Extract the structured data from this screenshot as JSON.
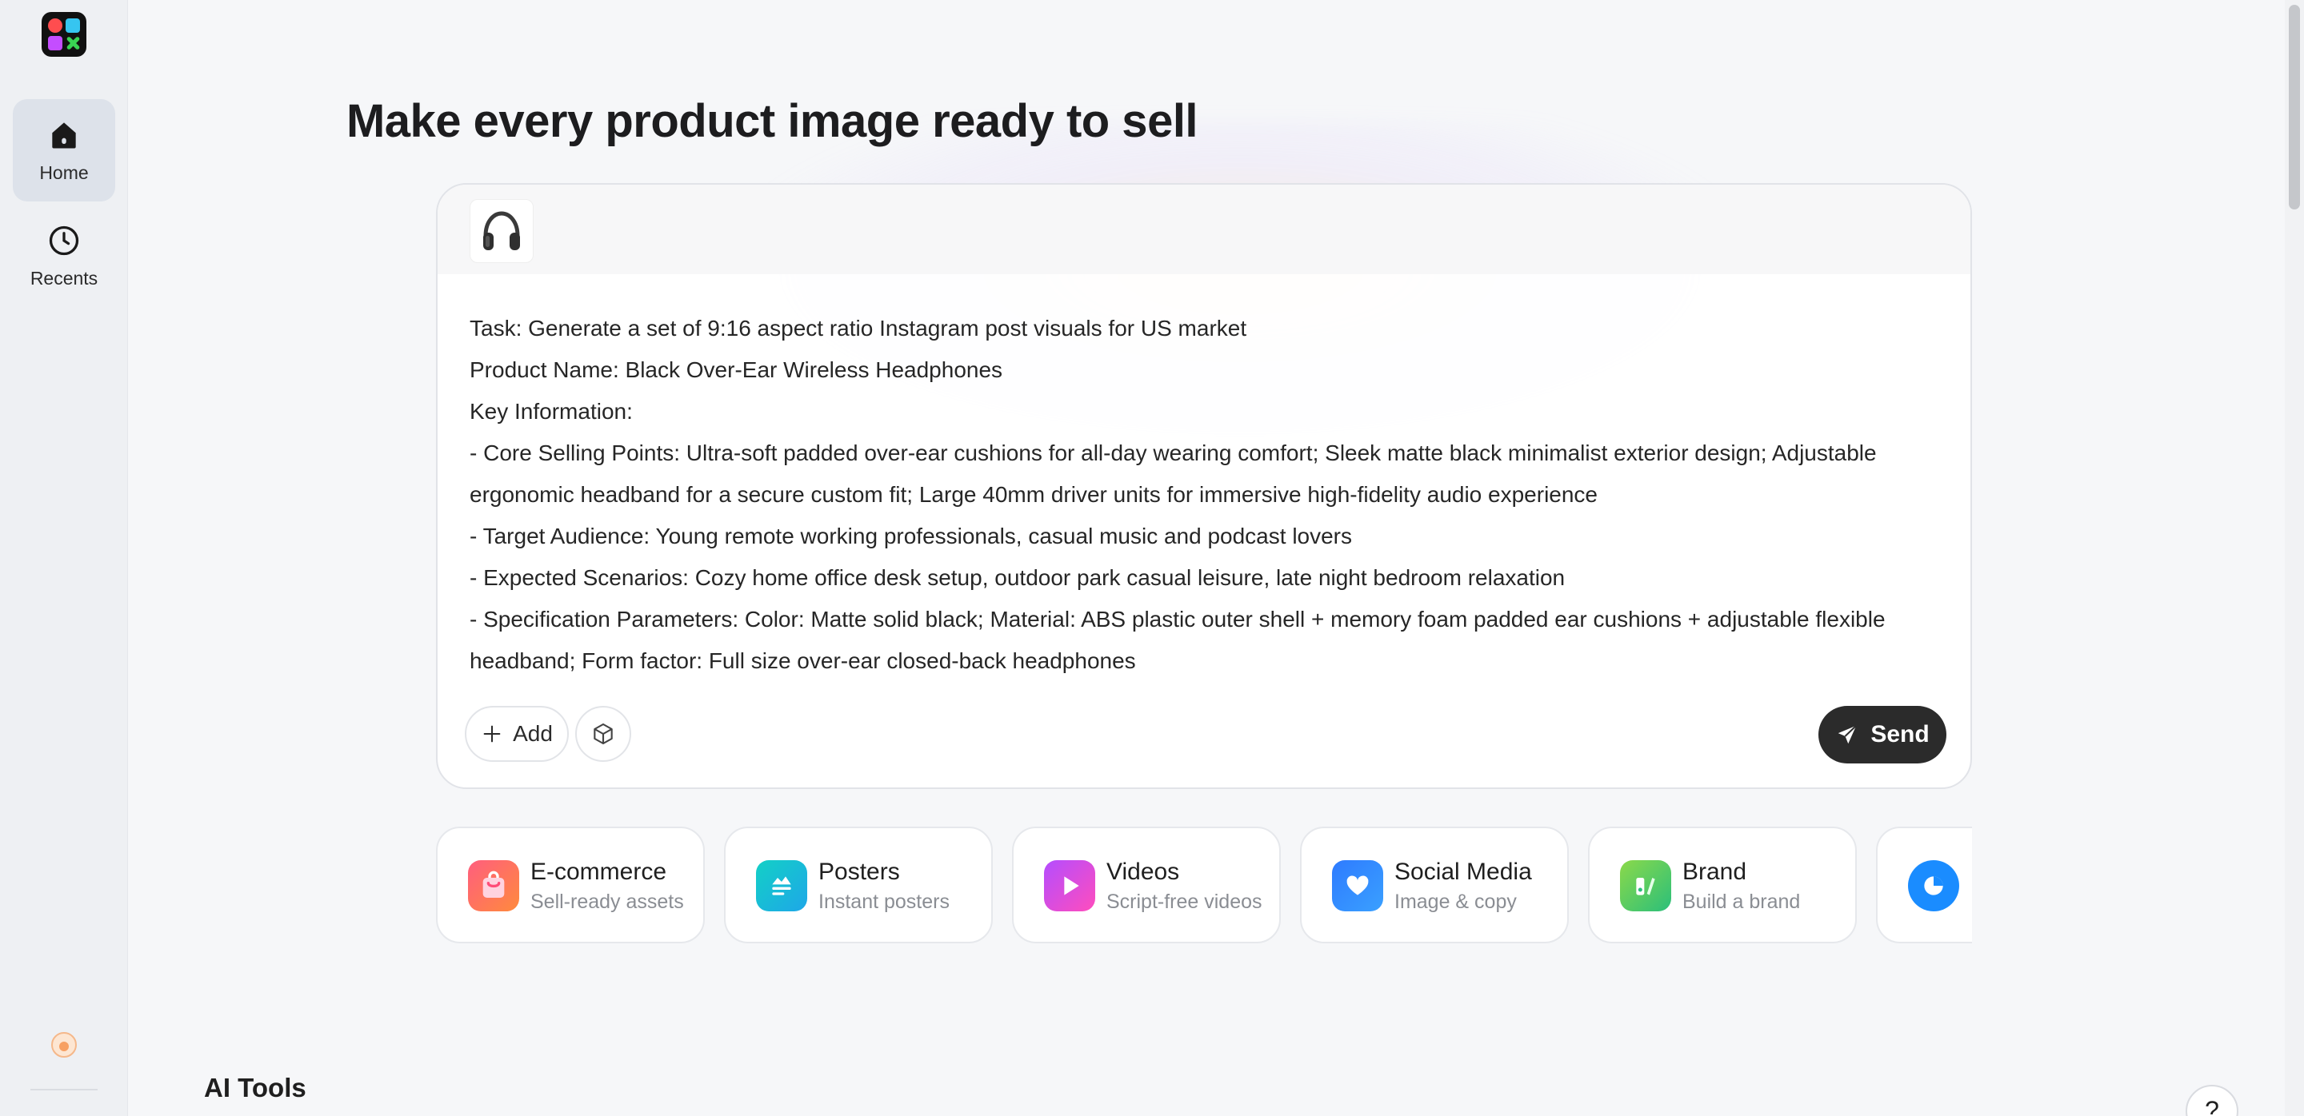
{
  "sidebar": {
    "items": [
      {
        "label": "Home",
        "icon": "home-icon",
        "active": true
      },
      {
        "label": "Recents",
        "icon": "clock-icon",
        "active": false
      }
    ]
  },
  "hero": {
    "title": "Make every product image ready to sell"
  },
  "composer": {
    "lines": [
      "Task: Generate a set of 9:16 aspect ratio Instagram post visuals for US market",
      "Product Name: Black Over-Ear Wireless Headphones",
      "Key Information:",
      "- Core Selling Points: Ultra-soft padded over-ear cushions for all-day wearing comfort; Sleek matte black minimalist exterior design; Adjustable ergonomic headband for a secure custom fit; Large 40mm driver units for immersive high-fidelity audio experience",
      "- Target Audience: Young remote working professionals, casual music and podcast lovers",
      "- Expected Scenarios: Cozy home office desk setup, outdoor park casual leisure, late night bedroom relaxation",
      "- Specification Parameters: Color: Matte solid black; Material: ABS plastic outer shell + memory foam padded ear cushions + adjustable flexible headband; Form factor: Full size over-ear closed-back headphones"
    ],
    "add_label": "Add",
    "send_label": "Send"
  },
  "categories": [
    {
      "title": "E-commerce",
      "subtitle": "Sell-ready assets",
      "icon": "shopping-bag-icon",
      "color": "#ff6a3d"
    },
    {
      "title": "Posters",
      "subtitle": "Instant posters",
      "icon": "poster-icon",
      "color": "#1ec8d8"
    },
    {
      "title": "Videos",
      "subtitle": "Script-free videos",
      "icon": "play-icon",
      "color": "#d64dff"
    },
    {
      "title": "Social Media",
      "subtitle": "Image & copy",
      "icon": "heart-chat-icon",
      "color": "#2e7bff"
    },
    {
      "title": "Brand",
      "subtitle": "Build a brand",
      "icon": "brand-icon",
      "color": "#3fc46a"
    },
    {
      "title": "",
      "subtitle": "",
      "icon": "pie-chart-icon",
      "color": "#1a8cff"
    }
  ],
  "sections": {
    "ai_tools_title": "AI Tools"
  },
  "help": {
    "label": "?"
  }
}
